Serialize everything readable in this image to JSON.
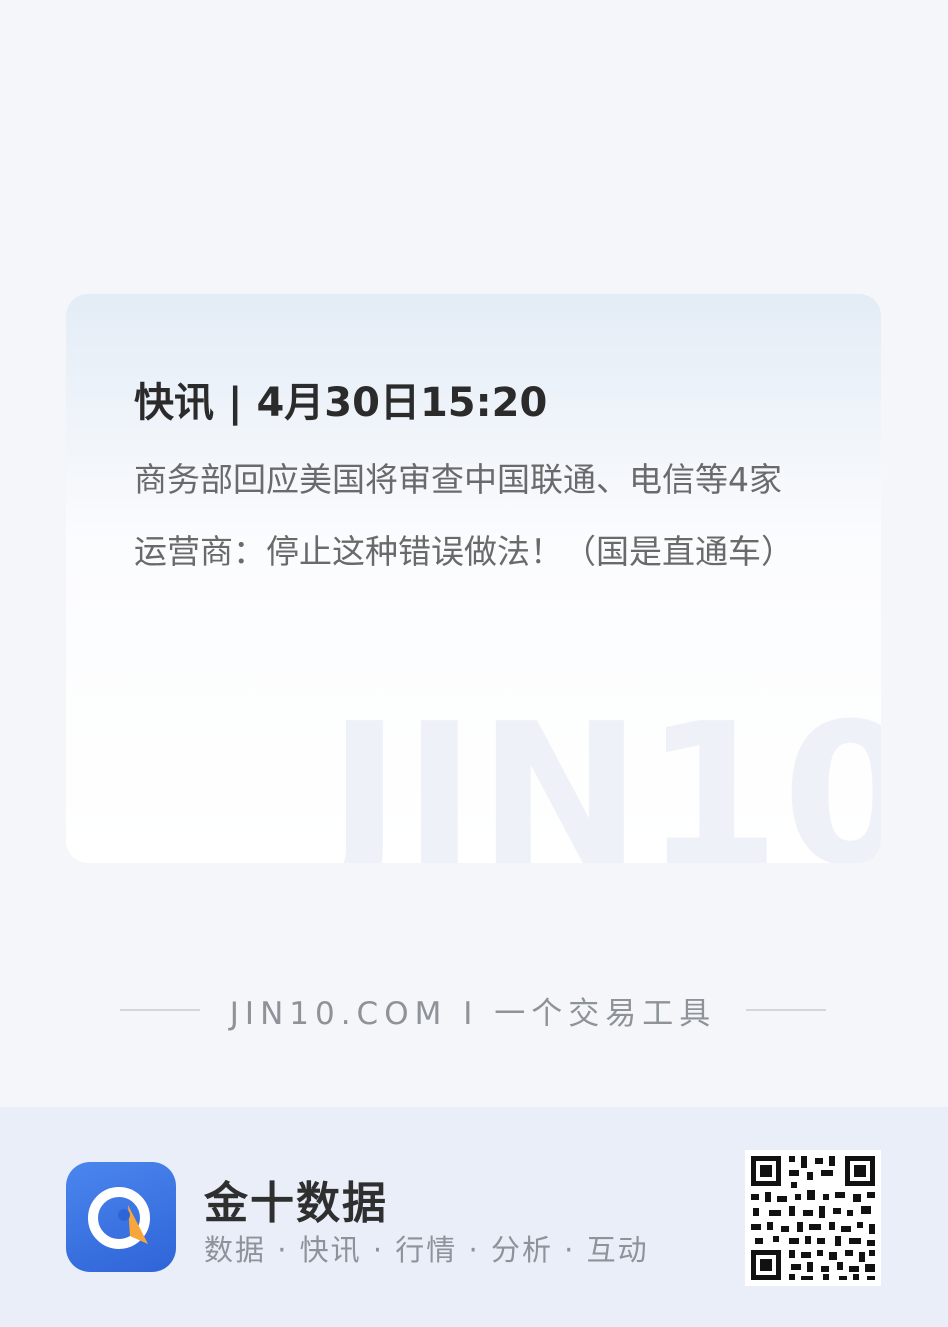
{
  "card": {
    "title": "快讯 | 4月30日15:20",
    "body": "商务部回应美国将审查中国联通、电信等4家运营商：停止这种错误做法！（国是直通车）",
    "watermark": "JIN10"
  },
  "tagline": {
    "text": "JIN10.COM I 一个交易工具"
  },
  "footer": {
    "app_name": "金十数据",
    "slogan": "数据 · 快讯 · 行情 · 分析 · 互动",
    "icon": "jin10-app-icon",
    "qr_icon": "qr-code-icon"
  },
  "colors": {
    "background": "#f4f6f9",
    "footer_background": "#e9eef8",
    "brand_blue": "#3b72e4",
    "accent_orange": "#f7a63b"
  }
}
